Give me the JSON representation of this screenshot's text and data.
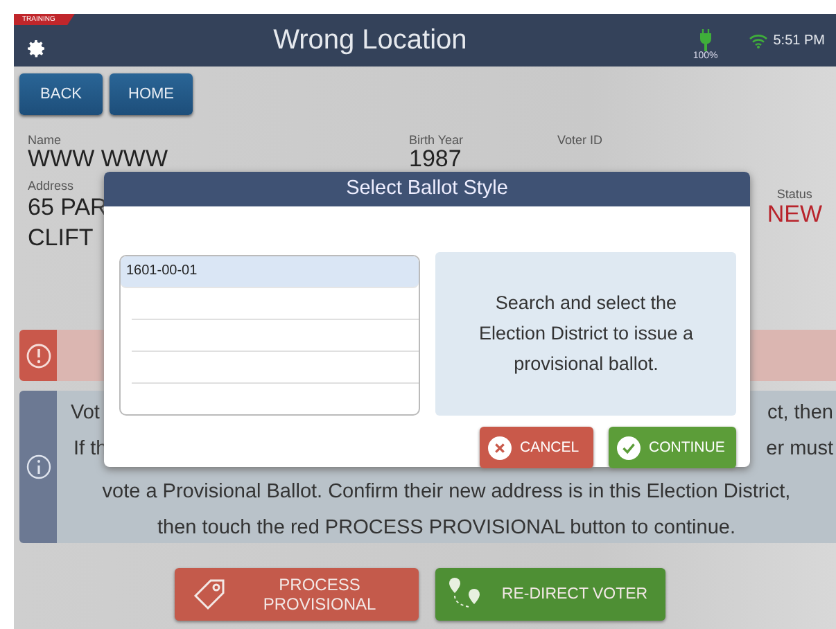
{
  "status_bar": {
    "badge": "TRAINING",
    "title": "Wrong Location",
    "battery": "100%",
    "time": "5:51 PM"
  },
  "nav_buttons": [
    "BACK",
    "HOME"
  ],
  "voter": {
    "name_label": "Name",
    "name": "WWW WWW",
    "birth_year_label": "Birth Year",
    "birth_year": "1987",
    "voter_id_label": "Voter ID",
    "address_label": "Address",
    "address_lines": [
      "65 PAR",
      "CLIFT"
    ],
    "status_label": "Status",
    "status": "NEW"
  },
  "info": {
    "partial_lines": [
      {
        "left": "Vot",
        "right": "ct, then"
      },
      {
        "left": "If th",
        "right": "er must"
      }
    ],
    "lines": [
      "vote a Provisional Ballot. Confirm their new address is in this Election District,",
      "then touch the red PROCESS PROVISIONAL button to continue."
    ]
  },
  "actions": [
    {
      "kind": "provisional",
      "label": "PROCESS PROVISIONAL"
    },
    {
      "kind": "redirect",
      "label": "RE-DIRECT VOTER"
    }
  ],
  "dialog": {
    "title": "Select Ballot Style",
    "districts": [
      {
        "label": "1601-00-01",
        "selected": true
      }
    ],
    "hint": "Search and select the Election District to issue a provisional ballot.",
    "buttons": [
      {
        "kind": "cancel",
        "label": "CANCEL"
      },
      {
        "kind": "continue",
        "label": "CONTINUE"
      }
    ]
  }
}
